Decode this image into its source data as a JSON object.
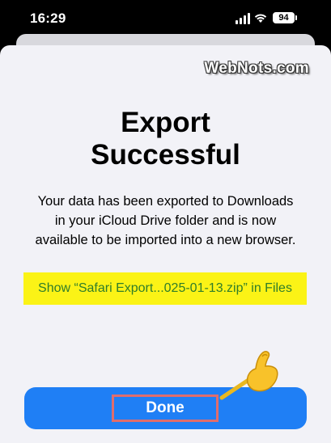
{
  "status_bar": {
    "time": "16:29",
    "battery": "94"
  },
  "watermark": "WebNots.com",
  "dialog": {
    "title_line1": "Export",
    "title_line2": "Successful",
    "message": "Your data has been exported to Downloads in your iCloud Drive folder and is now available to be imported into a new browser.",
    "files_link": "Show “Safari Export...025-01-13.zip” in Files",
    "done_label": "Done"
  },
  "colors": {
    "accent": "#1f7ff5",
    "highlight_yellow": "#fbf316",
    "link_green": "#2f7d2a",
    "annotation_border": "#e06d6d",
    "sheet_background": "#f2f2f7"
  },
  "icons": [
    "signal-icon",
    "wifi-icon",
    "battery-icon",
    "pointer-hand-icon"
  ]
}
